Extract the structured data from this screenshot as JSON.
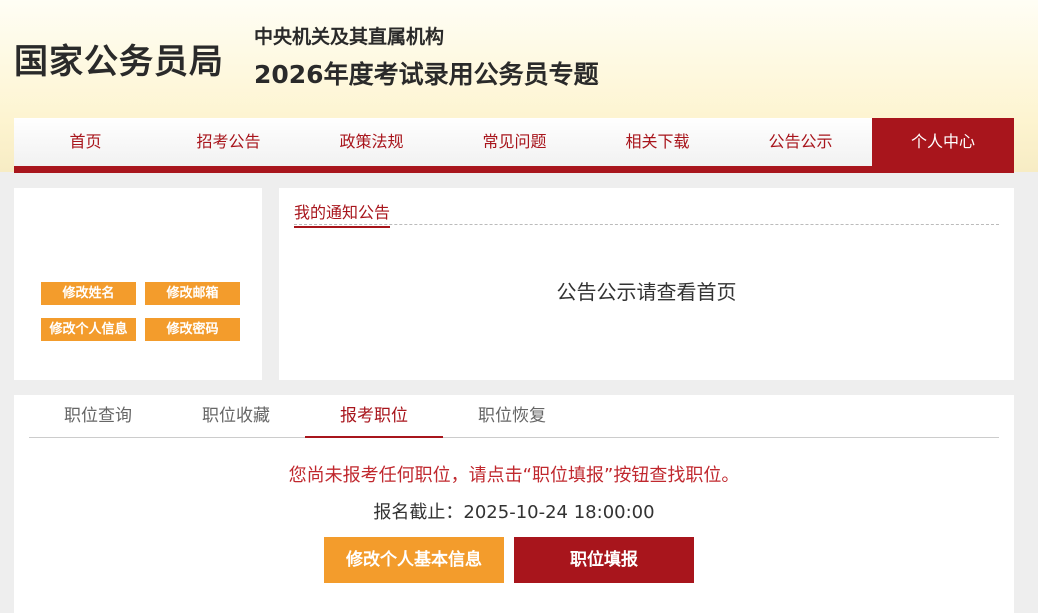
{
  "header": {
    "logo": "国家公务员局",
    "subtitle1": "中央机关及其直属机构",
    "subtitle2": "2026年度考试录用公务员专题"
  },
  "nav": {
    "items": [
      "首页",
      "招考公告",
      "政策法规",
      "常见问题",
      "相关下载",
      "公告公示",
      "个人中心"
    ],
    "active": "个人中心"
  },
  "profile": {
    "buttons": [
      "修改姓名",
      "修改邮箱",
      "修改个人信息",
      "修改密码"
    ]
  },
  "notice": {
    "title": "我的通知公告",
    "message": "公告公示请查看首页"
  },
  "positions": {
    "tabs": [
      "职位查询",
      "职位收藏",
      "报考职位",
      "职位恢复"
    ],
    "active_tab": "报考职位",
    "warning": "您尚未报考任何职位，请点击“职位填报”按钮查找职位。",
    "deadline": "报名截止：2025-10-24 18:00:00",
    "edit_button": "修改个人基本信息",
    "fill_button": "职位填报"
  },
  "colors": {
    "brand_red": "#a8151c",
    "accent_orange": "#f39c2c"
  }
}
